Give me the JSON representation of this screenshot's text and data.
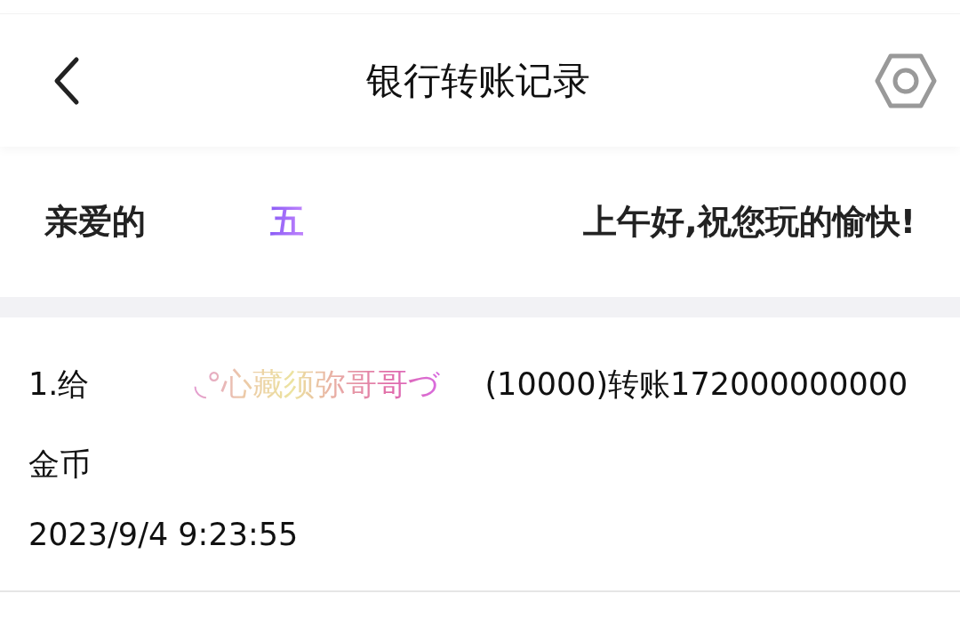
{
  "header": {
    "title": "银行转账记录"
  },
  "greeting": {
    "prefix": "亲爱的",
    "name": "五",
    "message": "上午好,祝您玩的愉快!"
  },
  "records": [
    {
      "prefix": "1.给",
      "recipient": "◟°心藏须弥哥哥づ",
      "suffix": "(10000)转账172000000000金币",
      "time": "2023/9/4 9:23:55"
    }
  ]
}
